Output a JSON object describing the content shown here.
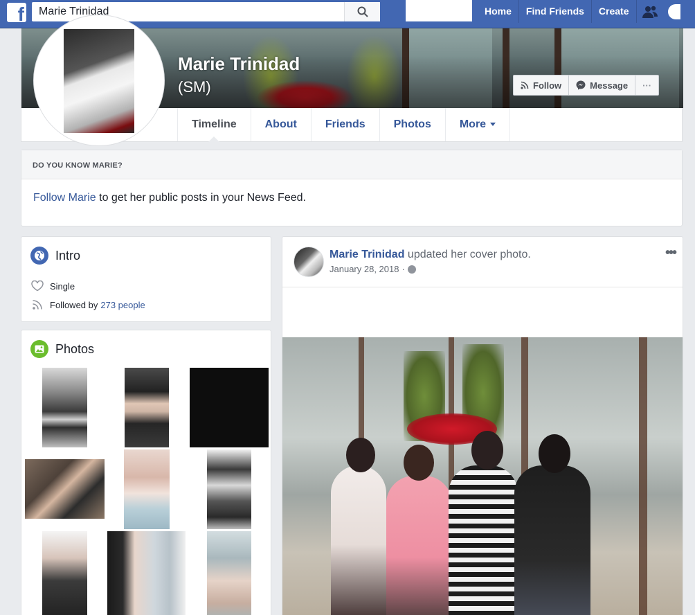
{
  "topbar": {
    "search_value": "Marie Trinidad",
    "nav": [
      "Home",
      "Find Friends",
      "Create"
    ]
  },
  "profile": {
    "name": "Marie Trinidad",
    "alt_name": "(SM)",
    "actions": {
      "follow": "Follow",
      "message": "Message",
      "more": "···"
    },
    "tabs": [
      "Timeline",
      "About",
      "Friends",
      "Photos",
      "More"
    ]
  },
  "know": {
    "heading": "DO YOU KNOW MARIE?",
    "link": "Follow Marie",
    "text": " to get her public posts in your News Feed."
  },
  "intro": {
    "title": "Intro",
    "relationship": "Single",
    "followed_prefix": "Followed by",
    "followed_link": "273 people"
  },
  "photos": {
    "title": "Photos"
  },
  "post": {
    "author": "Marie Trinidad",
    "action": " updated her cover photo.",
    "date": "January 28, 2018",
    "date_sep": "·",
    "more": "•••"
  },
  "colors": {
    "brand": "#4267b2",
    "link": "#365899",
    "intro_icon": "#4267b2",
    "photos_icon": "#6bbd2d"
  },
  "icons": [
    "facebook-logo-icon",
    "search-icon",
    "friends-icon",
    "rss-icon",
    "messenger-icon",
    "globe-icon",
    "heart-icon",
    "photo-icon"
  ]
}
